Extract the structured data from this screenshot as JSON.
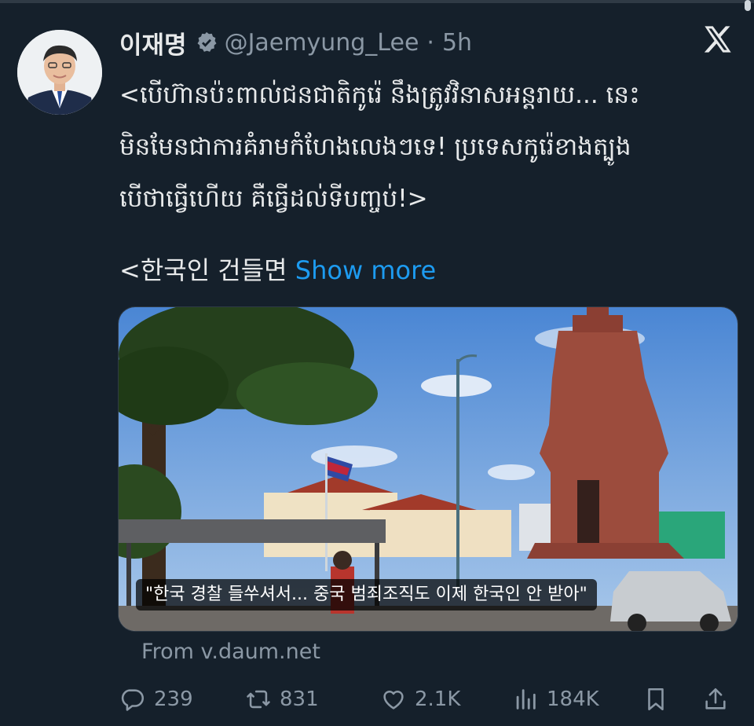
{
  "tweet": {
    "author_name": "이재명",
    "handle": "@Jaemyung_Lee",
    "separator": "·",
    "time": "5h",
    "text": "<បើហ៊ានប៉ះពាល់ជនជាតិកូរ៉េ នឹងត្រូវវិនាសអន្តរាយ... នេះ\nមិនមែនជាការគំរាមកំហែងលេងៗទេ! ប្រទេសកូរ៉េខាងត្បូង\nបើថាធ្វើហើយ គឺធ្វើដល់ទីបញ្ចប់!>",
    "text2": "<한국인 건들면",
    "show_more": "Show more",
    "card_caption": "\"한국 경찰 들쑤셔서... 중국 범죄조직도 이제 한국인 안 받아\"",
    "card_source": "From v.daum.net"
  },
  "actions": {
    "replies": "239",
    "reposts": "831",
    "likes": "2.1K",
    "views": "184K"
  },
  "icons": {
    "verified": "verified-badge-icon",
    "platform": "x-logo-icon",
    "reply": "reply-icon",
    "repost": "repost-icon",
    "like": "heart-icon",
    "views": "views-icon",
    "bookmark": "bookmark-icon",
    "share": "share-icon"
  },
  "colors": {
    "background": "#15202b",
    "text": "#e7e9ea",
    "secondary": "#8b98a5",
    "link": "#1d9bf0"
  }
}
